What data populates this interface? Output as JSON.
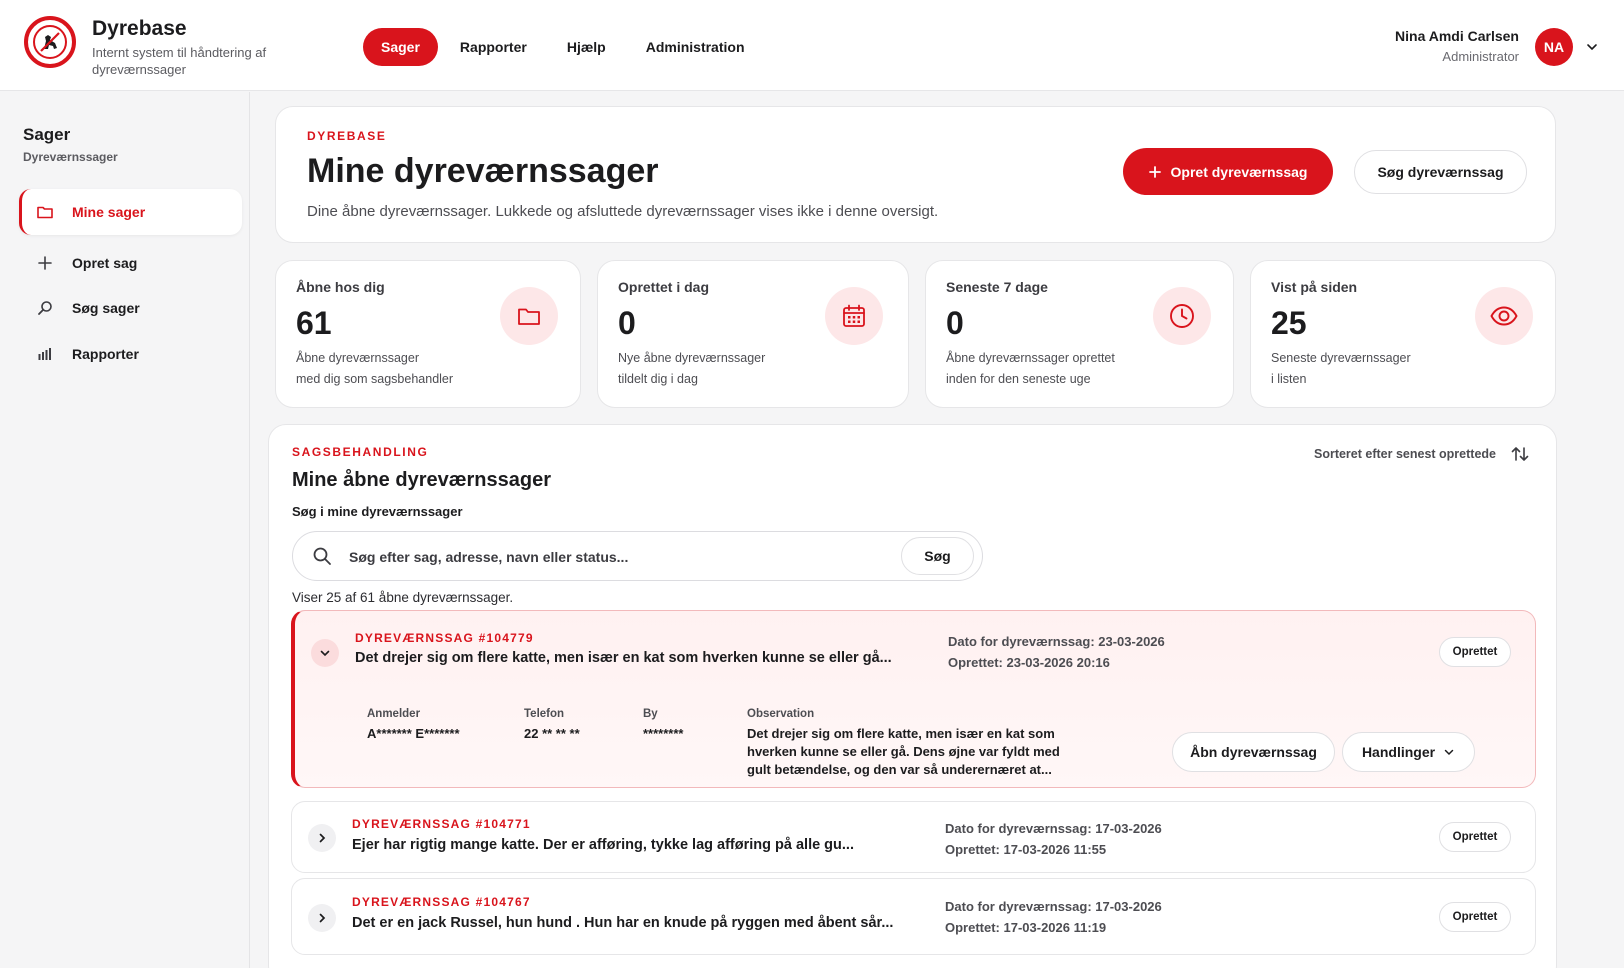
{
  "app": {
    "title": "Dyrebase",
    "subtitle": "Internt system til håndtering af dyreværnssager"
  },
  "nav": {
    "items": [
      {
        "label": "Sager",
        "active": true
      },
      {
        "label": "Rapporter",
        "active": false
      },
      {
        "label": "Hjælp",
        "active": false
      },
      {
        "label": "Administration",
        "active": false
      }
    ]
  },
  "user": {
    "name": "Nina Amdi Carlsen",
    "role": "Administrator",
    "initials": "NA"
  },
  "sidebar": {
    "title": "Sager",
    "subtitle": "Dyreværnssager",
    "items": [
      {
        "label": "Mine sager",
        "icon": "folder-icon",
        "active": true
      },
      {
        "label": "Opret sag",
        "icon": "plus-icon",
        "active": false
      },
      {
        "label": "Søg sager",
        "icon": "search-icon",
        "active": false
      },
      {
        "label": "Rapporter",
        "icon": "bar-chart-icon",
        "active": false
      }
    ]
  },
  "hero": {
    "eyebrow": "DYREBASE",
    "title": "Mine dyreværnssager",
    "description": "Dine åbne dyreværnssager. Lukkede og afsluttede dyreværnssager vises ikke i denne oversigt.",
    "primary_button": "Opret dyreværnssag",
    "secondary_button": "Søg dyreværnssag"
  },
  "stats": [
    {
      "label": "Åbne hos dig",
      "value": "61",
      "desc1": "Åbne dyreværnssager",
      "desc2": "med dig som sagsbehandler",
      "icon": "folder-icon"
    },
    {
      "label": "Oprettet i dag",
      "value": "0",
      "desc1": "Nye åbne dyreværnssager",
      "desc2": "tildelt dig i dag",
      "icon": "calendar-icon"
    },
    {
      "label": "Seneste 7 dage",
      "value": "0",
      "desc1": "Åbne dyreværnssager oprettet",
      "desc2": "inden for den seneste uge",
      "icon": "clock-icon"
    },
    {
      "label": "Vist på siden",
      "value": "25",
      "desc1": "Seneste dyreværnssager",
      "desc2": "i listen",
      "icon": "eye-icon"
    }
  ],
  "list": {
    "eyebrow": "SAGSBEHANDLING",
    "title": "Mine åbne dyreværnssager",
    "search_label": "Søg i mine dyreværnssager",
    "search_placeholder": "Søg efter sag, adresse, navn eller status...",
    "search_button": "Søg",
    "sort_label": "Sorteret efter senest oprettede",
    "count_text": "Viser 25 af 61 åbne dyreværnssager."
  },
  "cases": [
    {
      "id": "DYREVÆRNSSAG #104779",
      "text": "Det drejer sig om flere katte, men især en kat som hverken kunne se eller gå...",
      "date": "Dato for dyreværnssag: 23-03-2026",
      "created": "Oprettet: 23-03-2026 20:16",
      "status": "Oprettet",
      "expanded": true,
      "details": {
        "reporter_label": "Anmelder",
        "reporter": "A******* E*******",
        "phone_label": "Telefon",
        "phone": "22 ** ** **",
        "city_label": "By",
        "city": "********",
        "observation_label": "Observation",
        "observation": "Det drejer sig om flere katte, men især en kat som hverken kunne se eller gå. Dens øjne var fyldt med gult betændelse, og den var så underernæret at...",
        "open_button": "Åbn dyreværnssag",
        "actions_button": "Handlinger"
      }
    },
    {
      "id": "DYREVÆRNSSAG #104771",
      "text": "Ejer har rigtig mange katte. Der er afføring, tykke lag afføring på alle gu...",
      "date": "Dato for dyreværnssag: 17-03-2026",
      "created": "Oprettet: 17-03-2026 11:55",
      "status": "Oprettet",
      "expanded": false
    },
    {
      "id": "DYREVÆRNSSAG #104767",
      "text": "Det er en jack Russel, hun hund . Hun har en knude på ryggen med åbent sår...",
      "date": "Dato for dyreværnssag: 17-03-2026",
      "created": "Oprettet: 17-03-2026 11:19",
      "status": "Oprettet",
      "expanded": false
    }
  ],
  "colors": {
    "accent": "#d9141c",
    "accent_soft": "#fde7e8",
    "background": "#f5f5f6"
  }
}
